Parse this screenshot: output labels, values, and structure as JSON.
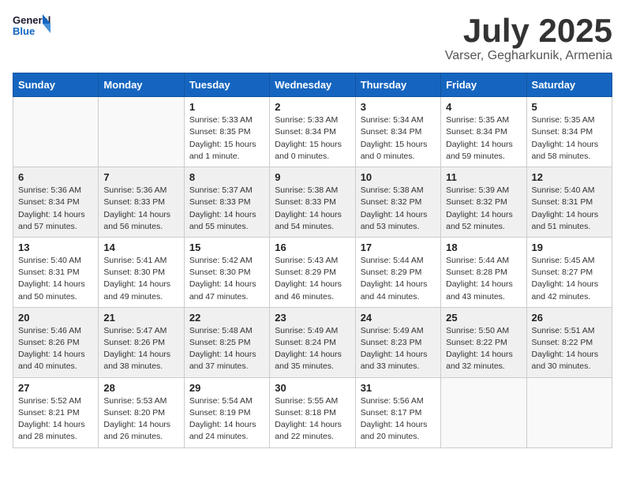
{
  "header": {
    "logo_general": "General",
    "logo_blue": "Blue",
    "month_title": "July 2025",
    "location": "Varser, Gegharkunik, Armenia"
  },
  "calendar": {
    "days_of_week": [
      "Sunday",
      "Monday",
      "Tuesday",
      "Wednesday",
      "Thursday",
      "Friday",
      "Saturday"
    ],
    "weeks": [
      [
        {
          "day": "",
          "sunrise": "",
          "sunset": "",
          "daylight": ""
        },
        {
          "day": "",
          "sunrise": "",
          "sunset": "",
          "daylight": ""
        },
        {
          "day": "1",
          "sunrise": "Sunrise: 5:33 AM",
          "sunset": "Sunset: 8:35 PM",
          "daylight": "Daylight: 15 hours and 1 minute."
        },
        {
          "day": "2",
          "sunrise": "Sunrise: 5:33 AM",
          "sunset": "Sunset: 8:34 PM",
          "daylight": "Daylight: 15 hours and 0 minutes."
        },
        {
          "day": "3",
          "sunrise": "Sunrise: 5:34 AM",
          "sunset": "Sunset: 8:34 PM",
          "daylight": "Daylight: 15 hours and 0 minutes."
        },
        {
          "day": "4",
          "sunrise": "Sunrise: 5:35 AM",
          "sunset": "Sunset: 8:34 PM",
          "daylight": "Daylight: 14 hours and 59 minutes."
        },
        {
          "day": "5",
          "sunrise": "Sunrise: 5:35 AM",
          "sunset": "Sunset: 8:34 PM",
          "daylight": "Daylight: 14 hours and 58 minutes."
        }
      ],
      [
        {
          "day": "6",
          "sunrise": "Sunrise: 5:36 AM",
          "sunset": "Sunset: 8:34 PM",
          "daylight": "Daylight: 14 hours and 57 minutes."
        },
        {
          "day": "7",
          "sunrise": "Sunrise: 5:36 AM",
          "sunset": "Sunset: 8:33 PM",
          "daylight": "Daylight: 14 hours and 56 minutes."
        },
        {
          "day": "8",
          "sunrise": "Sunrise: 5:37 AM",
          "sunset": "Sunset: 8:33 PM",
          "daylight": "Daylight: 14 hours and 55 minutes."
        },
        {
          "day": "9",
          "sunrise": "Sunrise: 5:38 AM",
          "sunset": "Sunset: 8:33 PM",
          "daylight": "Daylight: 14 hours and 54 minutes."
        },
        {
          "day": "10",
          "sunrise": "Sunrise: 5:38 AM",
          "sunset": "Sunset: 8:32 PM",
          "daylight": "Daylight: 14 hours and 53 minutes."
        },
        {
          "day": "11",
          "sunrise": "Sunrise: 5:39 AM",
          "sunset": "Sunset: 8:32 PM",
          "daylight": "Daylight: 14 hours and 52 minutes."
        },
        {
          "day": "12",
          "sunrise": "Sunrise: 5:40 AM",
          "sunset": "Sunset: 8:31 PM",
          "daylight": "Daylight: 14 hours and 51 minutes."
        }
      ],
      [
        {
          "day": "13",
          "sunrise": "Sunrise: 5:40 AM",
          "sunset": "Sunset: 8:31 PM",
          "daylight": "Daylight: 14 hours and 50 minutes."
        },
        {
          "day": "14",
          "sunrise": "Sunrise: 5:41 AM",
          "sunset": "Sunset: 8:30 PM",
          "daylight": "Daylight: 14 hours and 49 minutes."
        },
        {
          "day": "15",
          "sunrise": "Sunrise: 5:42 AM",
          "sunset": "Sunset: 8:30 PM",
          "daylight": "Daylight: 14 hours and 47 minutes."
        },
        {
          "day": "16",
          "sunrise": "Sunrise: 5:43 AM",
          "sunset": "Sunset: 8:29 PM",
          "daylight": "Daylight: 14 hours and 46 minutes."
        },
        {
          "day": "17",
          "sunrise": "Sunrise: 5:44 AM",
          "sunset": "Sunset: 8:29 PM",
          "daylight": "Daylight: 14 hours and 44 minutes."
        },
        {
          "day": "18",
          "sunrise": "Sunrise: 5:44 AM",
          "sunset": "Sunset: 8:28 PM",
          "daylight": "Daylight: 14 hours and 43 minutes."
        },
        {
          "day": "19",
          "sunrise": "Sunrise: 5:45 AM",
          "sunset": "Sunset: 8:27 PM",
          "daylight": "Daylight: 14 hours and 42 minutes."
        }
      ],
      [
        {
          "day": "20",
          "sunrise": "Sunrise: 5:46 AM",
          "sunset": "Sunset: 8:26 PM",
          "daylight": "Daylight: 14 hours and 40 minutes."
        },
        {
          "day": "21",
          "sunrise": "Sunrise: 5:47 AM",
          "sunset": "Sunset: 8:26 PM",
          "daylight": "Daylight: 14 hours and 38 minutes."
        },
        {
          "day": "22",
          "sunrise": "Sunrise: 5:48 AM",
          "sunset": "Sunset: 8:25 PM",
          "daylight": "Daylight: 14 hours and 37 minutes."
        },
        {
          "day": "23",
          "sunrise": "Sunrise: 5:49 AM",
          "sunset": "Sunset: 8:24 PM",
          "daylight": "Daylight: 14 hours and 35 minutes."
        },
        {
          "day": "24",
          "sunrise": "Sunrise: 5:49 AM",
          "sunset": "Sunset: 8:23 PM",
          "daylight": "Daylight: 14 hours and 33 minutes."
        },
        {
          "day": "25",
          "sunrise": "Sunrise: 5:50 AM",
          "sunset": "Sunset: 8:22 PM",
          "daylight": "Daylight: 14 hours and 32 minutes."
        },
        {
          "day": "26",
          "sunrise": "Sunrise: 5:51 AM",
          "sunset": "Sunset: 8:22 PM",
          "daylight": "Daylight: 14 hours and 30 minutes."
        }
      ],
      [
        {
          "day": "27",
          "sunrise": "Sunrise: 5:52 AM",
          "sunset": "Sunset: 8:21 PM",
          "daylight": "Daylight: 14 hours and 28 minutes."
        },
        {
          "day": "28",
          "sunrise": "Sunrise: 5:53 AM",
          "sunset": "Sunset: 8:20 PM",
          "daylight": "Daylight: 14 hours and 26 minutes."
        },
        {
          "day": "29",
          "sunrise": "Sunrise: 5:54 AM",
          "sunset": "Sunset: 8:19 PM",
          "daylight": "Daylight: 14 hours and 24 minutes."
        },
        {
          "day": "30",
          "sunrise": "Sunrise: 5:55 AM",
          "sunset": "Sunset: 8:18 PM",
          "daylight": "Daylight: 14 hours and 22 minutes."
        },
        {
          "day": "31",
          "sunrise": "Sunrise: 5:56 AM",
          "sunset": "Sunset: 8:17 PM",
          "daylight": "Daylight: 14 hours and 20 minutes."
        },
        {
          "day": "",
          "sunrise": "",
          "sunset": "",
          "daylight": ""
        },
        {
          "day": "",
          "sunrise": "",
          "sunset": "",
          "daylight": ""
        }
      ]
    ]
  }
}
